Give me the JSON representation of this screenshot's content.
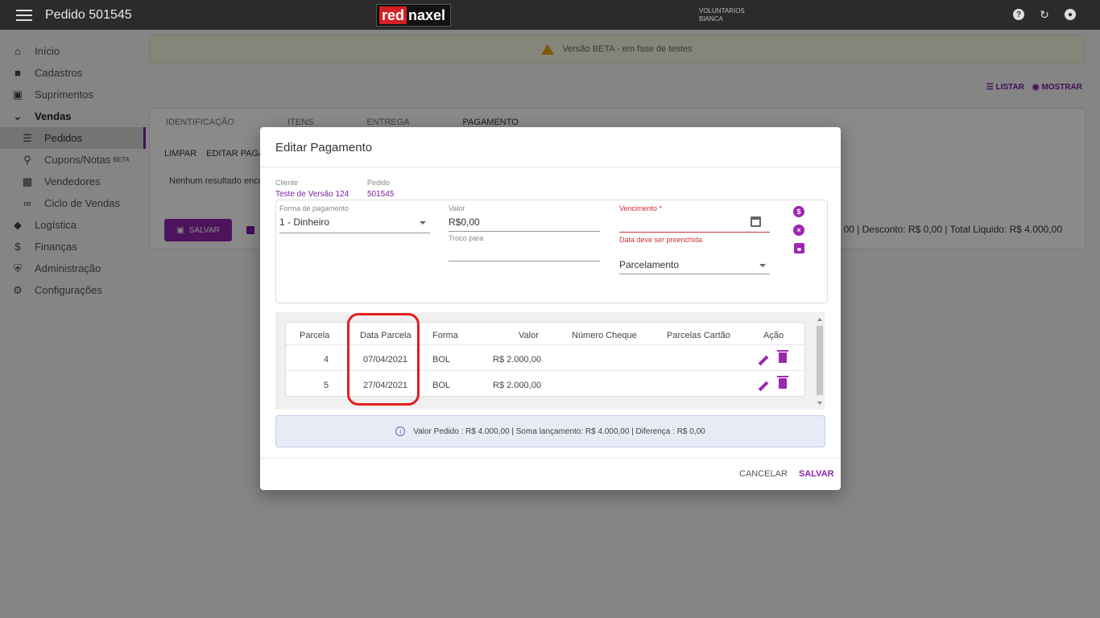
{
  "header": {
    "title": "Pedido 501545",
    "logo_red": "red",
    "logo_white": "naxel",
    "org_line1": "VOLUNTARIOS",
    "org_line2": "BIANCA"
  },
  "sidebar": {
    "items": [
      {
        "label": "Início",
        "icon": "home-icon"
      },
      {
        "label": "Cadastros",
        "icon": "folder-icon"
      },
      {
        "label": "Suprimentos",
        "icon": "briefcase-icon"
      },
      {
        "label": "Vendas",
        "icon": "chevron-down-icon"
      },
      {
        "label": "Pedidos",
        "icon": "list-icon"
      },
      {
        "label": "Cupons/Notas",
        "icon": "receipt-icon",
        "badge": "BETA"
      },
      {
        "label": "Vendedores",
        "icon": "id-card-icon"
      },
      {
        "label": "Ciclo de Vendas",
        "icon": "infinity-icon"
      },
      {
        "label": "Logística",
        "icon": "directions-icon"
      },
      {
        "label": "Finanças",
        "icon": "dollar-icon"
      },
      {
        "label": "Administração",
        "icon": "shield-icon"
      },
      {
        "label": "Configurações",
        "icon": "gear-icon"
      }
    ]
  },
  "banner": {
    "text": "Versão BETA - em fase de testes"
  },
  "list_actions": {
    "listar": "LISTAR",
    "mostrar": "MOSTRAR"
  },
  "tabs": [
    "IDENTIFICAÇÃO",
    "ITENS",
    "ENTREGA",
    "PAGAMENTO"
  ],
  "card": {
    "btn_limpar": "LIMPAR",
    "btn_editar": "EDITAR PAGA",
    "no_result": "Nenhum resultado enco",
    "save_label": "SALVAR",
    "totals": "00 | Desconto: R$ 0,00 | Total Liquido: R$ 4.000,00"
  },
  "dialog": {
    "title": "Editar Pagamento",
    "cliente_label": "Cliente",
    "cliente_value": "Teste de Versão 124",
    "pedido_label": "Pedido",
    "pedido_value": "501545",
    "forma_label": "Forma de pagamento",
    "forma_value": "1 - Dinheiro",
    "valor_label": "Valor",
    "valor_value": "R$0,00",
    "troco_label": "Troco para",
    "troco_value": "",
    "vencimento_label": "Vencimento *",
    "vencimento_error": "Data deve ser preenchida",
    "parcelamento_value": "Parcelamento",
    "table": {
      "headers": [
        "Parcela",
        "Data Parcela",
        "Forma",
        "Valor",
        "Número Cheque",
        "Parcelas Cartão",
        "Ação"
      ],
      "rows": [
        {
          "parcela": "4",
          "data": "07/04/2021",
          "forma": "BOL",
          "valor": "R$ 2.000,00",
          "cheque": "",
          "cartao": ""
        },
        {
          "parcela": "5",
          "data": "27/04/2021",
          "forma": "BOL",
          "valor": "R$ 2.000,00",
          "cheque": "",
          "cartao": ""
        }
      ]
    },
    "summary": "Valor Pedido : R$ 4.000,00 | Soma lançamento: R$ 4.000,00 | Diferença : R$ 0,00",
    "cancel_label": "CANCELAR",
    "save_label": "SALVAR"
  },
  "colors": {
    "accent": "#8e24aa",
    "error": "#d32f2f",
    "highlight": "#e51e1e"
  }
}
